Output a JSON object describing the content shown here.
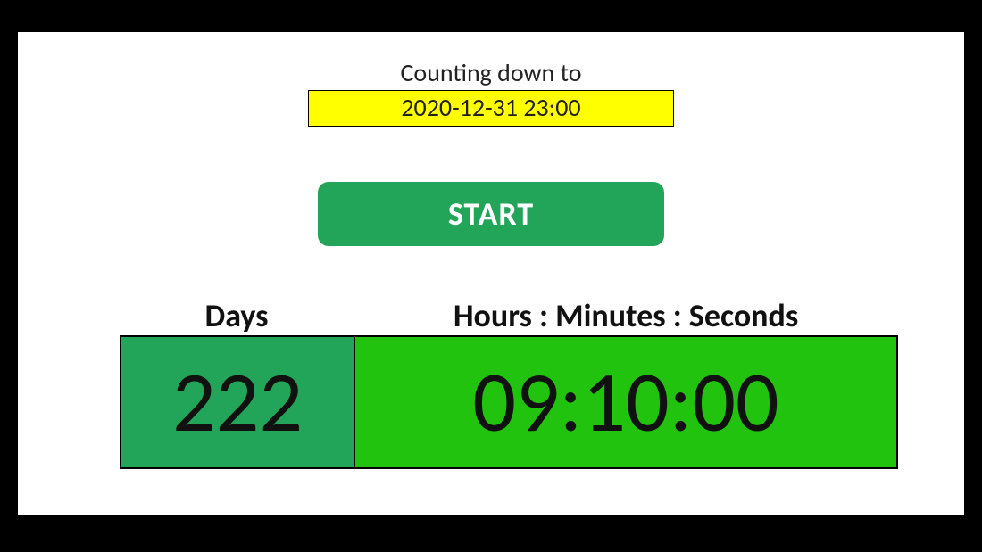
{
  "countdown": {
    "label": "Counting down to",
    "target_datetime": "2020-12-31 23:00"
  },
  "controls": {
    "start_label": "START"
  },
  "headers": {
    "days": "Days",
    "hms": "Hours : Minutes : Seconds"
  },
  "remaining": {
    "days": "222",
    "hms": "09:10:00"
  }
}
